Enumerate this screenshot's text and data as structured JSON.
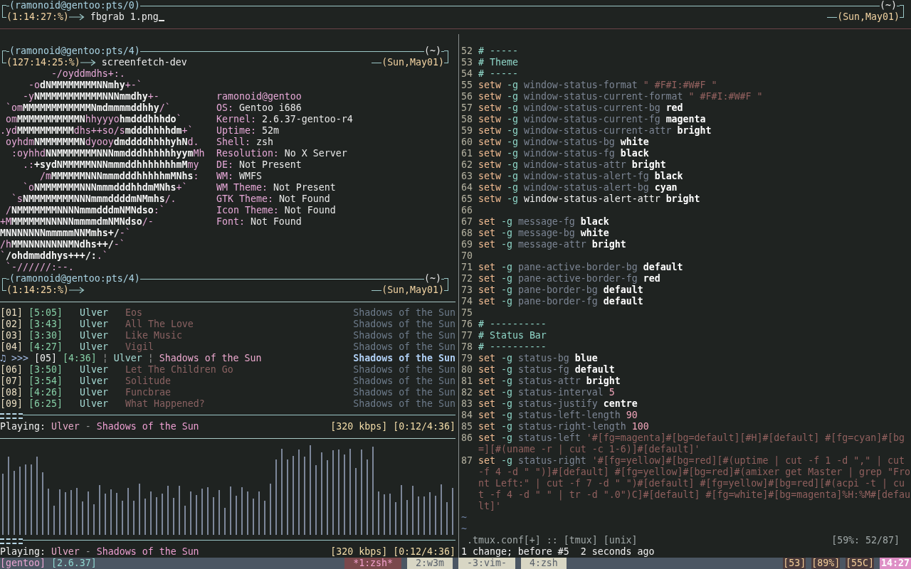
{
  "top_pane": {
    "prompt": {
      "user": "(ramonoid@gentoo:pts/0)",
      "directory": "(~)",
      "status": "(1:14:27:%)",
      "command": "fbgrab 1.png",
      "cursor": true,
      "date": "(Sun,May01)"
    }
  },
  "screenfetch_pane": {
    "prompt": {
      "user": "(ramonoid@gentoo:pts/4)",
      "directory": "(~)",
      "status": "(127:14:25:%)",
      "command": "screenfetch-dev",
      "date": "(Sun,May01)"
    },
    "logo_lines": [
      [
        {
          "kind": "accent",
          "text": "         -/oyddmdhs+:."
        }
      ],
      [
        {
          "kind": "accent",
          "text": "     -o"
        },
        {
          "kind": "plain",
          "text": "dNMMMMMMMMNNmhy"
        },
        {
          "kind": "accent",
          "text": "+-`"
        }
      ],
      [
        {
          "kind": "accent",
          "text": "    -y"
        },
        {
          "kind": "plain",
          "text": "NMMMMMMMMMMMNNNmmdhy"
        },
        {
          "kind": "accent",
          "text": "+-"
        }
      ],
      [
        {
          "kind": "accent",
          "text": " `om"
        },
        {
          "kind": "plain",
          "text": "MMMMMMMMMMMMNmdmmmmddhhy"
        },
        {
          "kind": "accent",
          "text": "/`"
        }
      ],
      [
        {
          "kind": "accent",
          "text": " om"
        },
        {
          "kind": "plain",
          "text": "MMMMMMMMMMMN"
        },
        {
          "kind": "accent",
          "text": "hhyyyo"
        },
        {
          "kind": "plain",
          "text": "hmdddhhhdo"
        },
        {
          "kind": "accent",
          "text": "`"
        }
      ],
      [
        {
          "kind": "accent",
          "text": ".yd"
        },
        {
          "kind": "plain",
          "text": "MMMMMMMMMM"
        },
        {
          "kind": "accent",
          "text": "dhs++so/s"
        },
        {
          "kind": "plain",
          "text": "mdddhhhhdm"
        },
        {
          "kind": "accent",
          "text": "+`"
        }
      ],
      [
        {
          "kind": "accent",
          "text": " oyhdm"
        },
        {
          "kind": "plain",
          "text": "NMMMMMMMN"
        },
        {
          "kind": "accent",
          "text": "dyooy"
        },
        {
          "kind": "plain",
          "text": "dmddddhhhhyhN"
        },
        {
          "kind": "accent",
          "text": "d."
        }
      ],
      [
        {
          "kind": "accent",
          "text": "  :oyhhd"
        },
        {
          "kind": "plain",
          "text": "NNMMMMMMMNNNmmdddhhhhhhyym"
        },
        {
          "kind": "accent",
          "text": "Mh"
        }
      ],
      [
        {
          "kind": "accent",
          "text": "    .:"
        },
        {
          "kind": "plain",
          "text": "+sydNMMMMMNNNmmmddhhhhhhhmM"
        },
        {
          "kind": "accent",
          "text": "my"
        }
      ],
      [
        {
          "kind": "accent",
          "text": "       /m"
        },
        {
          "kind": "plain",
          "text": "MMMMMMNNNmmmdddhhhhhmMNhs"
        },
        {
          "kind": "accent",
          "text": ":"
        }
      ],
      [
        {
          "kind": "accent",
          "text": "    `o"
        },
        {
          "kind": "plain",
          "text": "NMMMMMMMNNNmmmdddhhdmMNhs"
        },
        {
          "kind": "accent",
          "text": "+`"
        }
      ],
      [
        {
          "kind": "accent",
          "text": "  `s"
        },
        {
          "kind": "plain",
          "text": "NMMMMMMMMNNNmmmddddmNMmhs"
        },
        {
          "kind": "accent",
          "text": "/."
        }
      ],
      [
        {
          "kind": "accent",
          "text": " /"
        },
        {
          "kind": "plain",
          "text": "NMMMMMMMNNNNmmmdddmNMNdso"
        },
        {
          "kind": "accent",
          "text": ":`"
        }
      ],
      [
        {
          "kind": "accent",
          "text": "+M"
        },
        {
          "kind": "plain",
          "text": "MMMMMMNNNNNmmmmdmNMNdso"
        },
        {
          "kind": "accent",
          "text": "/-"
        }
      ],
      [
        {
          "kind": "plain",
          "text": "MNNNNNNNmmmmmNNMmhs+/"
        },
        {
          "kind": "accent",
          "text": "-`"
        }
      ],
      [
        {
          "kind": "accent",
          "text": "/h"
        },
        {
          "kind": "plain",
          "text": "MMNNNNNNNNMNdhs++/"
        },
        {
          "kind": "accent",
          "text": "-`"
        }
      ],
      [
        {
          "kind": "accent",
          "text": "`"
        },
        {
          "kind": "plain",
          "text": "/ohdmmddhys+++/:"
        },
        {
          "kind": "accent",
          "text": ".`"
        }
      ],
      [
        {
          "kind": "accent",
          "text": " `-//////:--."
        }
      ]
    ],
    "info": [
      {
        "kind": "title",
        "text": "ramonoid@gentoo"
      },
      {
        "kind": "field",
        "label": "OS:",
        "value": "Gentoo i686"
      },
      {
        "kind": "field",
        "label": "Kernel:",
        "value": "2.6.37-gentoo-r4"
      },
      {
        "kind": "field",
        "label": "Uptime:",
        "value": "52m"
      },
      {
        "kind": "field",
        "label": "Shell:",
        "value": "zsh"
      },
      {
        "kind": "field",
        "label": "Resolution:",
        "value": "No X Server"
      },
      {
        "kind": "field",
        "label": "DE:",
        "value": "Not Present"
      },
      {
        "kind": "field",
        "label": "WM:",
        "value": "WMFS"
      },
      {
        "kind": "field",
        "label": "WM Theme:",
        "value": "Not Present"
      },
      {
        "kind": "field",
        "label": "GTK Theme:",
        "value": "Not Found"
      },
      {
        "kind": "field",
        "label": "Icon Theme:",
        "value": "Not Found"
      },
      {
        "kind": "field",
        "label": "Font:",
        "value": "Not Found"
      }
    ],
    "prompt_2": {
      "user": "(ramonoid@gentoo:pts/4)",
      "directory": "(~)",
      "status": "(1:14:25:%)",
      "date": "(Sun,May01)"
    }
  },
  "playlist_pane": {
    "rows": [
      {
        "number": "[01]",
        "length": "[5:05]",
        "artist": "Ulver",
        "title": "Eos",
        "album": "Shadows of the Sun",
        "playing": false
      },
      {
        "number": "[02]",
        "length": "[3:43]",
        "artist": "Ulver",
        "title": "All The Love",
        "album": "Shadows of the Sun",
        "playing": false
      },
      {
        "number": "[03]",
        "length": "[3:30]",
        "artist": "Ulver",
        "title": "Like Music",
        "album": "Shadows of the Sun",
        "playing": false
      },
      {
        "number": "[04]",
        "length": "[4:27]",
        "artist": "Ulver",
        "title": "Vigil",
        "album": "Shadows of the Sun",
        "playing": false
      },
      {
        "prefix": "♫ >>>",
        "number": "[05]",
        "length": "[4:36]",
        "separators": [
          "¦",
          "¦"
        ],
        "artist": "Ulver",
        "title": "Shadows of the Sun",
        "album": "Shadows of the Sun",
        "playing": true
      },
      {
        "number": "[06]",
        "length": "[3:50]",
        "artist": "Ulver",
        "title": "Let The Children Go",
        "album": "Shadows of the Sun",
        "playing": false
      },
      {
        "number": "[07]",
        "length": "[3:54]",
        "artist": "Ulver",
        "title": "Solitude",
        "album": "Shadows of the Sun",
        "playing": false
      },
      {
        "number": "[08]",
        "length": "[4:26]",
        "artist": "Ulver",
        "title": "Funcbrae",
        "album": "Shadows of the Sun",
        "playing": false
      },
      {
        "number": "[09]",
        "length": "[6:25]",
        "artist": "Ulver",
        "title": "What Happened?",
        "album": "Shadows of the Sun",
        "playing": false
      }
    ],
    "progress": {
      "level": 0.05
    },
    "now_playing": {
      "label": "Playing:",
      "artist": "Ulver",
      "dash": "-",
      "title": "Shadows of the Sun",
      "bitrate": "[320 kbps]",
      "time": "[0:12/4:36]"
    }
  },
  "visualizer_pane": {
    "progress": {
      "level": 0.05
    },
    "now_playing": {
      "label": "Playing:",
      "artist": "Ulver",
      "dash": "-",
      "title": "Shadows of the Sun",
      "bitrate": "[320 kbps]",
      "time": "[0:12/4:36]"
    }
  },
  "editor_pane": {
    "lines": [
      {
        "number": "52",
        "segments": [
          {
            "kind": "comment",
            "text": "# -----"
          }
        ]
      },
      {
        "number": "53",
        "segments": [
          {
            "kind": "comment",
            "text": "# Theme"
          }
        ]
      },
      {
        "number": "54",
        "segments": [
          {
            "kind": "comment",
            "text": "# -----"
          }
        ]
      },
      {
        "number": "55",
        "segments": [
          {
            "kind": "keyword",
            "text": "setw"
          },
          {
            "kind": "flag",
            "text": "-g"
          },
          {
            "kind": "option",
            "text": "window-status-format"
          },
          {
            "kind": "string",
            "text": "\" #F#I:#W#F \""
          }
        ]
      },
      {
        "number": "56",
        "segments": [
          {
            "kind": "keyword",
            "text": "setw"
          },
          {
            "kind": "flag",
            "text": "-g"
          },
          {
            "kind": "option",
            "text": "window-status-current-format"
          },
          {
            "kind": "string",
            "text": "\" #F#I:#W#F \""
          }
        ]
      },
      {
        "number": "57",
        "segments": [
          {
            "kind": "keyword",
            "text": "setw"
          },
          {
            "kind": "flag",
            "text": "-g"
          },
          {
            "kind": "option",
            "text": "window-status-current-bg"
          },
          {
            "kind": "value",
            "text": "red"
          }
        ]
      },
      {
        "number": "58",
        "segments": [
          {
            "kind": "keyword",
            "text": "setw"
          },
          {
            "kind": "flag",
            "text": "-g"
          },
          {
            "kind": "option",
            "text": "window-status-current-fg"
          },
          {
            "kind": "value",
            "text": "magenta"
          }
        ]
      },
      {
        "number": "59",
        "segments": [
          {
            "kind": "keyword",
            "text": "setw"
          },
          {
            "kind": "flag",
            "text": "-g"
          },
          {
            "kind": "option",
            "text": "window-status-current-attr"
          },
          {
            "kind": "value",
            "text": "bright"
          }
        ]
      },
      {
        "number": "60",
        "segments": [
          {
            "kind": "keyword",
            "text": "setw"
          },
          {
            "kind": "flag",
            "text": "-g"
          },
          {
            "kind": "option",
            "text": "window-status-bg"
          },
          {
            "kind": "value",
            "text": "white"
          }
        ]
      },
      {
        "number": "61",
        "segments": [
          {
            "kind": "keyword",
            "text": "setw"
          },
          {
            "kind": "flag",
            "text": "-g"
          },
          {
            "kind": "option",
            "text": "window-status-fg"
          },
          {
            "kind": "value",
            "text": "black"
          }
        ]
      },
      {
        "number": "62",
        "segments": [
          {
            "kind": "keyword",
            "text": "setw"
          },
          {
            "kind": "flag",
            "text": "-g"
          },
          {
            "kind": "option",
            "text": "window-status-attr"
          },
          {
            "kind": "value",
            "text": "bright"
          }
        ]
      },
      {
        "number": "63",
        "segments": [
          {
            "kind": "keyword",
            "text": "setw"
          },
          {
            "kind": "flag",
            "text": "-g"
          },
          {
            "kind": "option",
            "text": "window-status-alert-fg"
          },
          {
            "kind": "value",
            "text": "black"
          }
        ]
      },
      {
        "number": "64",
        "segments": [
          {
            "kind": "keyword",
            "text": "setw"
          },
          {
            "kind": "flag",
            "text": "-g"
          },
          {
            "kind": "option",
            "text": "window-status-alert-bg"
          },
          {
            "kind": "value",
            "text": "cyan"
          }
        ]
      },
      {
        "number": "65",
        "segments": [
          {
            "kind": "keyword",
            "text": "setw"
          },
          {
            "kind": "flag",
            "text": "-g"
          },
          {
            "kind": "unknown_option",
            "text": "window-status-alert-attr"
          },
          {
            "kind": "value",
            "text": "bright"
          }
        ]
      },
      {
        "number": "66"
      },
      {
        "number": "67",
        "segments": [
          {
            "kind": "keyword",
            "text": "set"
          },
          {
            "kind": "flag",
            "text": "-g"
          },
          {
            "kind": "option",
            "text": "message-fg"
          },
          {
            "kind": "value",
            "text": "black"
          }
        ]
      },
      {
        "number": "68",
        "segments": [
          {
            "kind": "keyword",
            "text": "set"
          },
          {
            "kind": "flag",
            "text": "-g"
          },
          {
            "kind": "option",
            "text": "message-bg"
          },
          {
            "kind": "value",
            "text": "white"
          }
        ]
      },
      {
        "number": "69",
        "segments": [
          {
            "kind": "keyword",
            "text": "set"
          },
          {
            "kind": "flag",
            "text": "-g"
          },
          {
            "kind": "option",
            "text": "message-attr"
          },
          {
            "kind": "value",
            "text": "bright"
          }
        ]
      },
      {
        "number": "70"
      },
      {
        "number": "71",
        "segments": [
          {
            "kind": "keyword",
            "text": "set"
          },
          {
            "kind": "flag",
            "text": "-g"
          },
          {
            "kind": "option",
            "text": "pane-active-border-bg"
          },
          {
            "kind": "value",
            "text": "default"
          }
        ]
      },
      {
        "number": "72",
        "segments": [
          {
            "kind": "keyword",
            "text": "set"
          },
          {
            "kind": "flag",
            "text": "-g"
          },
          {
            "kind": "option",
            "text": "pane-active-border-fg"
          },
          {
            "kind": "value",
            "text": "red"
          }
        ]
      },
      {
        "number": "73",
        "segments": [
          {
            "kind": "keyword",
            "text": "set"
          },
          {
            "kind": "flag",
            "text": "-g"
          },
          {
            "kind": "option",
            "text": "pane-border-bg"
          },
          {
            "kind": "value",
            "text": "default"
          }
        ]
      },
      {
        "number": "74",
        "segments": [
          {
            "kind": "keyword",
            "text": "set"
          },
          {
            "kind": "flag",
            "text": "-g"
          },
          {
            "kind": "option",
            "text": "pane-border-fg"
          },
          {
            "kind": "value",
            "text": "default"
          }
        ]
      },
      {
        "number": "75"
      },
      {
        "number": "76",
        "segments": [
          {
            "kind": "comment",
            "text": "# ----------"
          }
        ]
      },
      {
        "number": "77",
        "segments": [
          {
            "kind": "comment",
            "text": "# Status Bar"
          }
        ]
      },
      {
        "number": "78",
        "segments": [
          {
            "kind": "comment",
            "text": "# ----------"
          }
        ]
      },
      {
        "number": "79",
        "segments": [
          {
            "kind": "keyword",
            "text": "set"
          },
          {
            "kind": "flag",
            "text": "-g"
          },
          {
            "kind": "option",
            "text": "status-bg"
          },
          {
            "kind": "value",
            "text": "blue"
          }
        ]
      },
      {
        "number": "80",
        "segments": [
          {
            "kind": "keyword",
            "text": "set"
          },
          {
            "kind": "flag",
            "text": "-g"
          },
          {
            "kind": "option",
            "text": "status-fg"
          },
          {
            "kind": "value",
            "text": "default"
          }
        ]
      },
      {
        "number": "81",
        "segments": [
          {
            "kind": "keyword",
            "text": "set"
          },
          {
            "kind": "flag",
            "text": "-g"
          },
          {
            "kind": "option",
            "text": "status-attr"
          },
          {
            "kind": "value",
            "text": "bright"
          }
        ]
      },
      {
        "number": "82",
        "segments": [
          {
            "kind": "keyword",
            "text": "set"
          },
          {
            "kind": "flag",
            "text": "-g"
          },
          {
            "kind": "option",
            "text": "status-interval"
          },
          {
            "kind": "number",
            "text": "5"
          }
        ]
      },
      {
        "number": "83",
        "segments": [
          {
            "kind": "keyword",
            "text": "set"
          },
          {
            "kind": "flag",
            "text": "-g"
          },
          {
            "kind": "option",
            "text": "status-justify"
          },
          {
            "kind": "value",
            "text": "centre"
          }
        ]
      },
      {
        "number": "84",
        "segments": [
          {
            "kind": "keyword",
            "text": "set"
          },
          {
            "kind": "flag",
            "text": "-g"
          },
          {
            "kind": "option",
            "text": "status-left-length"
          },
          {
            "kind": "number",
            "text": "90"
          }
        ]
      },
      {
        "number": "85",
        "segments": [
          {
            "kind": "keyword",
            "text": "set"
          },
          {
            "kind": "flag",
            "text": "-g"
          },
          {
            "kind": "option",
            "text": "status-right-length"
          },
          {
            "kind": "number",
            "text": "100"
          }
        ]
      },
      {
        "number": "86",
        "segments": [
          {
            "kind": "keyword",
            "text": "set"
          },
          {
            "kind": "flag",
            "text": "-g"
          },
          {
            "kind": "option",
            "text": "status-left"
          },
          {
            "kind": "string",
            "text": "'#[fg=magenta]#[bg=default][#H]#[default] #[fg=cyan]#[bg=][#(uname -r | cut -c 1-6)]#[default]'"
          }
        ]
      },
      {
        "number": "87",
        "segments": [
          {
            "kind": "keyword",
            "text": "set"
          },
          {
            "kind": "flag",
            "text": "-g"
          },
          {
            "kind": "option",
            "text": "status-right"
          },
          {
            "kind": "string",
            "text": "'#[fg=yellow]#[bg=red][#(uptime | cut -f 1 -d \",\" | cut -f 4 -d \" \")]#[default] #[fg=yellow]#[bg=red]#(amixer get Master | grep \"Front Left:\" | cut -f 7 -d \" \")#[default] #[fg=yellow]#[bg=red][#(acpi -t | cut -f 4 -d \" \" | tr -d \".0\")C]#[default] #[fg=white]#[bg=magenta]%H:%M#[default]'"
          }
        ]
      }
    ],
    "filler": [
      "~",
      "~"
    ],
    "status_line": {
      "file": ".tmux.conf[+] :: [tmux] [unix]",
      "position": "[59%: 52/87]"
    },
    "message": "1 change; before #5  2 seconds ago"
  },
  "status_bar": {
    "session": "[gentoo]",
    "kernel": "[2.6.37]",
    "windows": [
      {
        "label": "*1:zsh*",
        "selected": true
      },
      {
        "label": "2:w3m",
        "selected": false
      },
      {
        "label": "-3:vim-",
        "selected": false
      },
      {
        "label": "4:zsh",
        "selected": false
      }
    ],
    "right": [
      {
        "kind": "stat",
        "text": "[53]"
      },
      {
        "kind": "stat",
        "text": "[89%]"
      },
      {
        "kind": "stat",
        "text": "[55C]"
      },
      {
        "kind": "clock",
        "text": "14:27"
      }
    ]
  }
}
